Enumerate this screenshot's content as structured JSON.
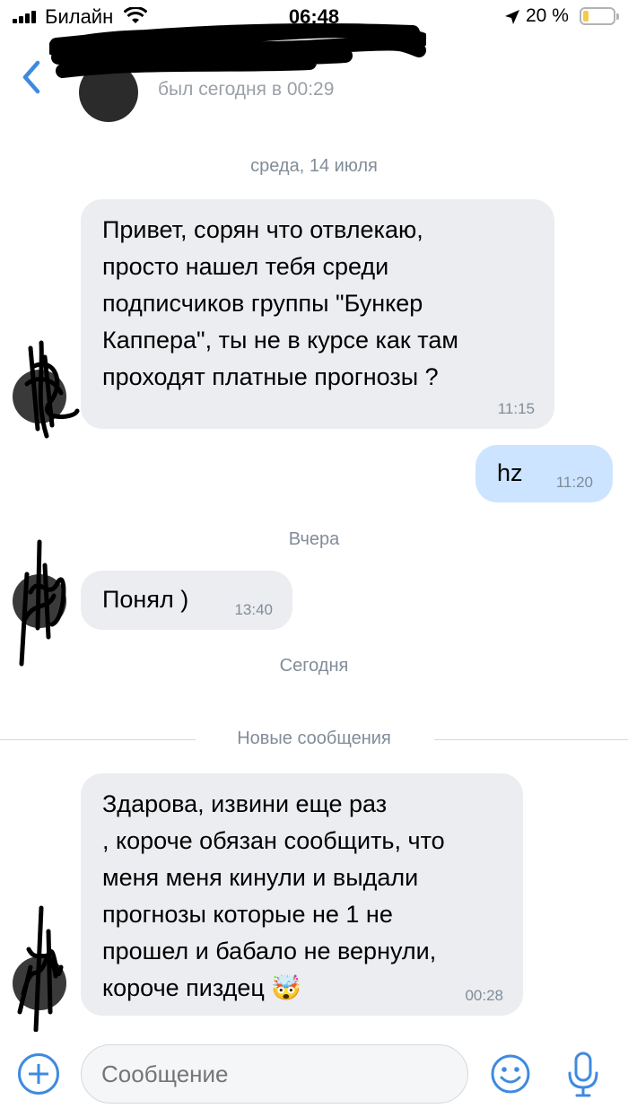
{
  "status_bar": {
    "carrier": "Билайн",
    "time": "06:48",
    "battery_percent_label": "20 %",
    "battery_level": 0.2
  },
  "header": {
    "back_icon": "chevron-left-icon",
    "chat_name": "",
    "last_seen": "был сегодня в 00:29"
  },
  "dates": {
    "wednesday": "среда, 14 июля",
    "yesterday": "Вчера",
    "today": "Сегодня"
  },
  "messages": [
    {
      "direction": "in",
      "text": "Привет, сорян что отвлекаю,\nпросто нашел тебя среди\nподписчиков группы \"Бункер\nКаппера\", ты не в курсе как там\nпроходят платные прогнозы ?",
      "time": "11:15"
    },
    {
      "direction": "out",
      "text": "hz",
      "time": "11:20"
    },
    {
      "direction": "in",
      "text": "Понял )",
      "time": "13:40"
    },
    {
      "direction": "in",
      "text": "Здарова, извини еще раз\n, короче обязан сообщить, что\nменя меня кинули и выдали\nпрогнозы которые не 1 не\nпрошел и бабало не вернули,\nкороче пиздец 🤯",
      "time": "00:28"
    }
  ],
  "new_messages_label": "Новые сообщения",
  "input": {
    "placeholder": "Сообщение"
  },
  "colors": {
    "accent": "#3f8ae0",
    "incoming_bubble": "#ebedf0",
    "outgoing_bubble": "#cce4ff",
    "secondary_text": "#818c99"
  }
}
